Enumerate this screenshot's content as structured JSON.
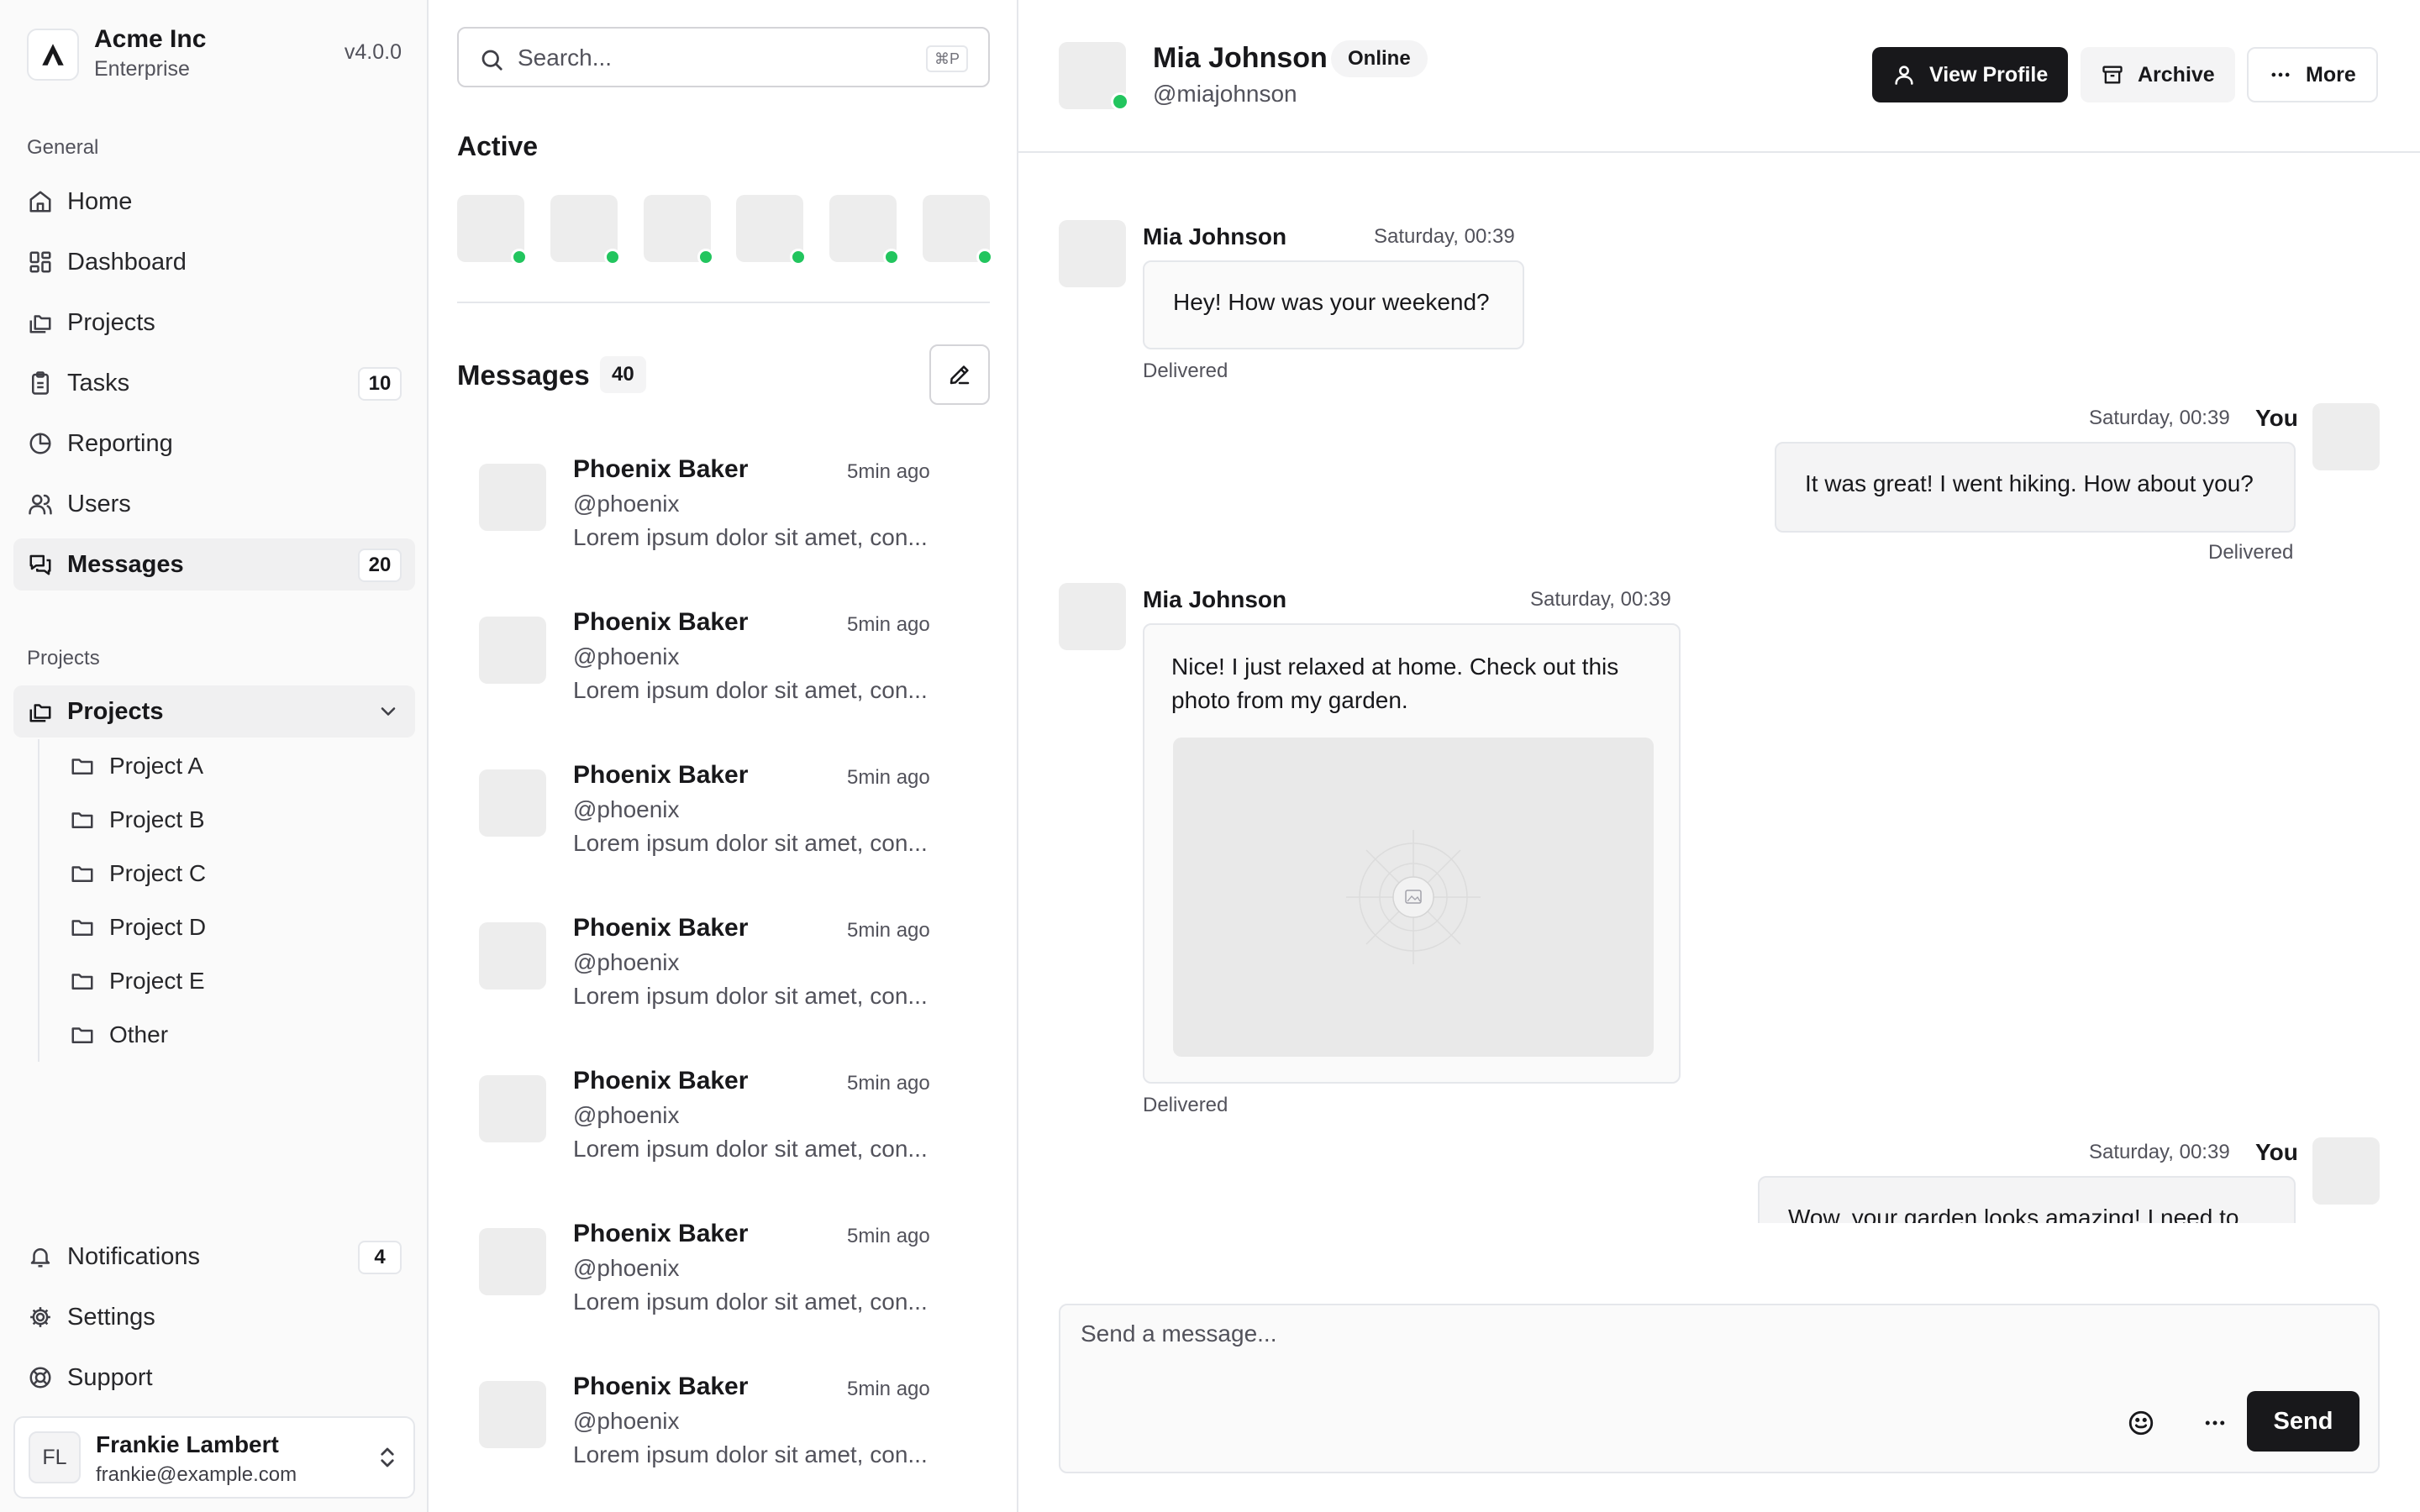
{
  "sidebar": {
    "brand": {
      "name": "Acme Inc",
      "plan": "Enterprise",
      "version": "v4.0.0"
    },
    "general_label": "General",
    "nav": [
      {
        "label": "Home",
        "icon": "home-icon"
      },
      {
        "label": "Dashboard",
        "icon": "dashboard-icon"
      },
      {
        "label": "Projects",
        "icon": "folders-icon"
      },
      {
        "label": "Tasks",
        "icon": "clipboard-icon",
        "badge": "10"
      },
      {
        "label": "Reporting",
        "icon": "pie-chart-icon"
      },
      {
        "label": "Users",
        "icon": "users-icon"
      },
      {
        "label": "Messages",
        "icon": "messages-icon",
        "badge": "20",
        "active": true
      }
    ],
    "projects_label": "Projects",
    "projects_group": {
      "label": "Projects",
      "expanded": true
    },
    "projects": [
      "Project A",
      "Project B",
      "Project C",
      "Project D",
      "Project E",
      "Other"
    ],
    "footer_nav": [
      {
        "label": "Notifications",
        "icon": "bell-icon",
        "badge": "4"
      },
      {
        "label": "Settings",
        "icon": "gear-icon"
      },
      {
        "label": "Support",
        "icon": "lifebuoy-icon"
      }
    ],
    "user": {
      "initials": "FL",
      "name": "Frankie Lambert",
      "email": "frankie@example.com"
    }
  },
  "list": {
    "search_placeholder": "Search...",
    "search_shortcut": "⌘P",
    "active_title": "Active",
    "active_count": 6,
    "messages_title": "Messages",
    "messages_count": "40",
    "conversations": [
      {
        "name": "Phoenix Baker",
        "handle": "@phoenix",
        "time": "5min ago",
        "preview": "Lorem ipsum dolor sit amet, con..."
      },
      {
        "name": "Phoenix Baker",
        "handle": "@phoenix",
        "time": "5min ago",
        "preview": "Lorem ipsum dolor sit amet, con..."
      },
      {
        "name": "Phoenix Baker",
        "handle": "@phoenix",
        "time": "5min ago",
        "preview": "Lorem ipsum dolor sit amet, con..."
      },
      {
        "name": "Phoenix Baker",
        "handle": "@phoenix",
        "time": "5min ago",
        "preview": "Lorem ipsum dolor sit amet, con..."
      },
      {
        "name": "Phoenix Baker",
        "handle": "@phoenix",
        "time": "5min ago",
        "preview": "Lorem ipsum dolor sit amet, con..."
      },
      {
        "name": "Phoenix Baker",
        "handle": "@phoenix",
        "time": "5min ago",
        "preview": "Lorem ipsum dolor sit amet, con..."
      },
      {
        "name": "Phoenix Baker",
        "handle": "@phoenix",
        "time": "5min ago",
        "preview": "Lorem ipsum dolor sit amet, con..."
      }
    ]
  },
  "chat": {
    "contact": {
      "name": "Mia Johnson",
      "status": "Online",
      "handle": "@miajohnson"
    },
    "actions": {
      "view_profile": "View Profile",
      "archive": "Archive",
      "more": "More"
    },
    "messages": [
      {
        "author": "Mia Johnson",
        "time": "Saturday, 00:39",
        "text": "Hey! How was your weekend?",
        "status": "Delivered"
      },
      {
        "author": "You",
        "time": "Saturday, 00:39",
        "text": "It was great! I went hiking. How about you?",
        "status": "Delivered"
      },
      {
        "author": "Mia Johnson",
        "time": "Saturday, 00:39",
        "text": "Nice! I just relaxed at home. Check out this photo from my garden.",
        "status": "Delivered",
        "has_image": true
      },
      {
        "author": "You",
        "time": "Saturday, 00:39",
        "text": "Wow, your garden looks amazing! I need to"
      }
    ],
    "composer": {
      "placeholder": "Send a message...",
      "send_label": "Send"
    }
  },
  "colors": {
    "accent": "#18181b",
    "online": "#22c55e",
    "border": "#e5e7eb",
    "sidebar_bg": "#fafafa"
  }
}
